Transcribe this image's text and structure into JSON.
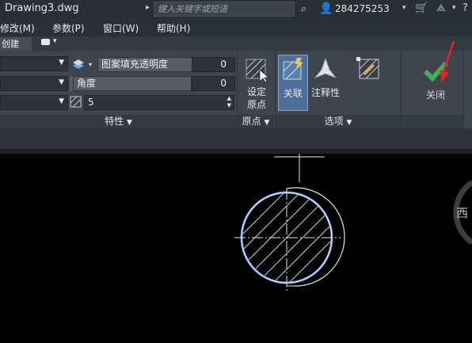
{
  "titlebar": {
    "doc_title": "Drawing3.dwg",
    "search_placeholder": "键入关键字或短语",
    "user_id": "284275253"
  },
  "menu": {
    "items": [
      "修改(M)",
      "参数(P)",
      "窗口(W)",
      "帮助(H)"
    ]
  },
  "ribbon": {
    "active_tab": "创建",
    "properties": {
      "transparency_label": "图案填充透明度",
      "transparency_value": "0",
      "angle_label": "角度",
      "angle_value": "0",
      "scale_value": "5",
      "panel_title": "特性"
    },
    "origin": {
      "set_origin_line1": "设定",
      "set_origin_line2": "原点",
      "panel_title": "原点"
    },
    "options": {
      "associative_label": "关联",
      "annotative_label": "注释性",
      "panel_title": "选项"
    },
    "close": {
      "close_label": "关闭"
    }
  },
  "canvas": {
    "viewcube_label": "西"
  },
  "colors": {
    "accent_blue": "#5b8fd8",
    "check_green": "#3fb34f",
    "annotation_red": "#e0242a"
  }
}
